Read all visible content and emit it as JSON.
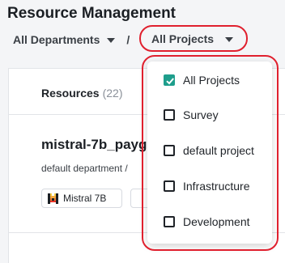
{
  "page": {
    "title": "Resource Management"
  },
  "breadcrumb": {
    "departments_label": "All Departments",
    "separator": "/",
    "projects_label": "All Projects"
  },
  "resources": {
    "title": "Resources",
    "count": "(22)",
    "card": {
      "name": "mistral-7b_payg",
      "subtitle": "default department /",
      "tag_label": "Mistral 7B",
      "tag_icon": "mistral-logo-icon"
    }
  },
  "project_dropdown": {
    "options": [
      {
        "label": "All Projects",
        "checked": true
      },
      {
        "label": "Survey",
        "checked": false
      },
      {
        "label": "default project",
        "checked": false
      },
      {
        "label": "Infrastructure",
        "checked": false
      },
      {
        "label": "Development",
        "checked": false
      }
    ]
  },
  "colors": {
    "highlight_outline": "#e0202e",
    "checkbox_checked": "#1e9e8c"
  }
}
